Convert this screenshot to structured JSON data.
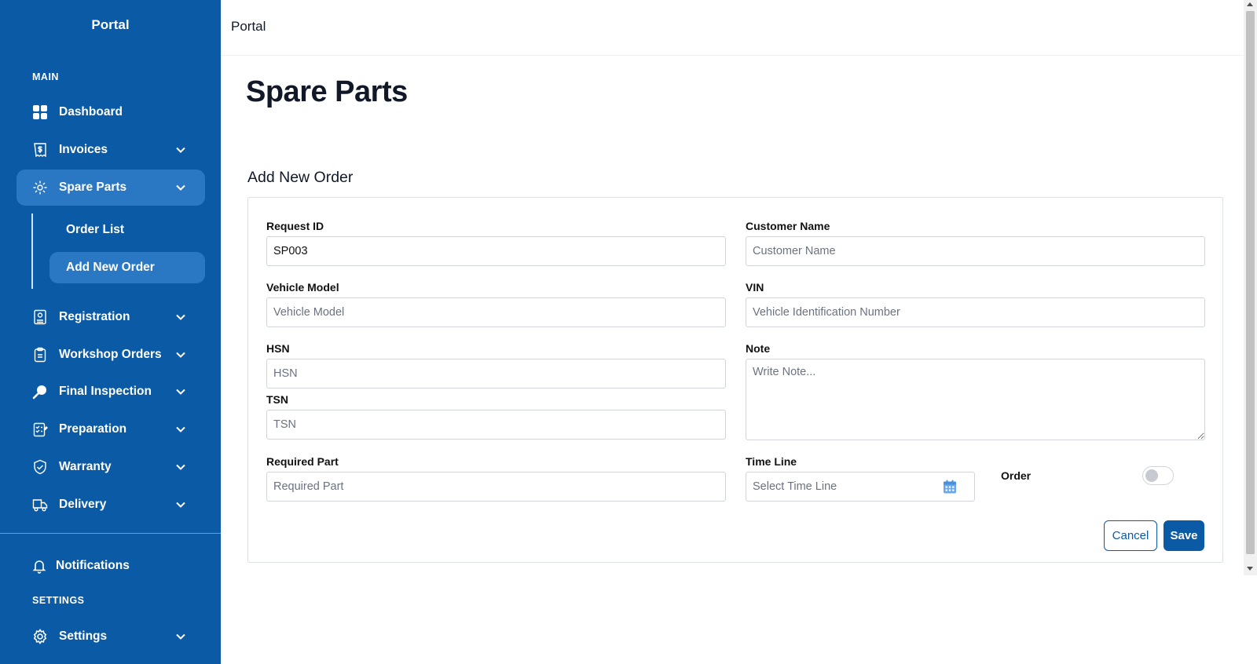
{
  "sidebar": {
    "brand": "Portal",
    "main_label": "MAIN",
    "settings_label": "SETTINGS",
    "items": [
      {
        "label": "Dashboard",
        "icon": "dashboard-icon"
      },
      {
        "label": "Invoices",
        "icon": "invoice-icon"
      },
      {
        "label": "Spare Parts",
        "icon": "gear-icon"
      },
      {
        "label": "Registration",
        "icon": "registration-icon"
      },
      {
        "label": "Workshop Orders",
        "icon": "clipboard-icon"
      },
      {
        "label": "Final Inspection",
        "icon": "magnifier-icon"
      },
      {
        "label": "Preparation",
        "icon": "checklist-icon"
      },
      {
        "label": "Warranty",
        "icon": "shield-icon"
      },
      {
        "label": "Delivery",
        "icon": "truck-icon"
      }
    ],
    "sub_items": [
      {
        "label": "Order List"
      },
      {
        "label": "Add New Order"
      }
    ],
    "notifications": "Notifications",
    "settings": "Settings"
  },
  "header": {
    "title": "Portal"
  },
  "page": {
    "title": "Spare Parts"
  },
  "form": {
    "title": "Add New Order",
    "request_id": {
      "label": "Request ID",
      "value": "SP003"
    },
    "customer_name": {
      "label": "Customer Name",
      "placeholder": "Customer Name"
    },
    "vehicle_model": {
      "label": "Vehicle Model",
      "placeholder": "Vehicle Model"
    },
    "vin": {
      "label": "VIN",
      "placeholder": "Vehicle Identification Number"
    },
    "hsn": {
      "label": "HSN",
      "placeholder": "HSN"
    },
    "note": {
      "label": "Note",
      "placeholder": "Write Note..."
    },
    "tsn": {
      "label": "TSN",
      "placeholder": "TSN"
    },
    "required_part": {
      "label": "Required Part",
      "placeholder": "Required Part"
    },
    "time_line": {
      "label": "Time Line",
      "placeholder": "Select Time Line"
    },
    "order": {
      "label": "Order",
      "enabled": false
    },
    "cancel": "Cancel",
    "save": "Save"
  },
  "colors": {
    "sidebar": "#0b5aa6",
    "active": "#2a78c4",
    "primary": "#0b5aa6"
  }
}
